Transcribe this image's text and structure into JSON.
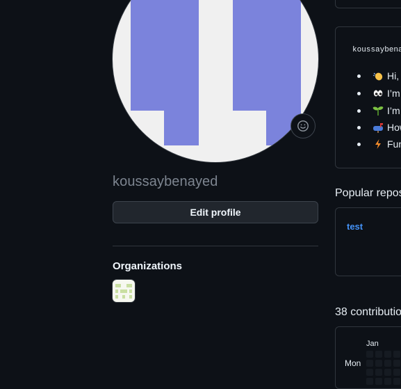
{
  "profile": {
    "username": "koussaybenayed",
    "edit_profile_label": "Edit profile"
  },
  "organizations": {
    "heading": "Organizations"
  },
  "readme": {
    "title": "koussaybena",
    "lines": [
      {
        "emoji": "waving-hand",
        "text": "Hi,"
      },
      {
        "emoji": "eyes",
        "text": "I’m"
      },
      {
        "emoji": "seedling",
        "text": "I’m"
      },
      {
        "emoji": "mailbox",
        "text": "How"
      },
      {
        "emoji": "zap",
        "text": "Fun"
      }
    ]
  },
  "popular_repos": {
    "heading": "Popular repos",
    "items": [
      {
        "name": "test"
      }
    ]
  },
  "contributions": {
    "heading": "38 contributio",
    "month_label": "Jan",
    "day_label": "Mon"
  },
  "colors": {
    "background": "#0d1117",
    "avatar_blue": "#7b83dc",
    "link": "#4493f8",
    "border": "#30363d"
  }
}
